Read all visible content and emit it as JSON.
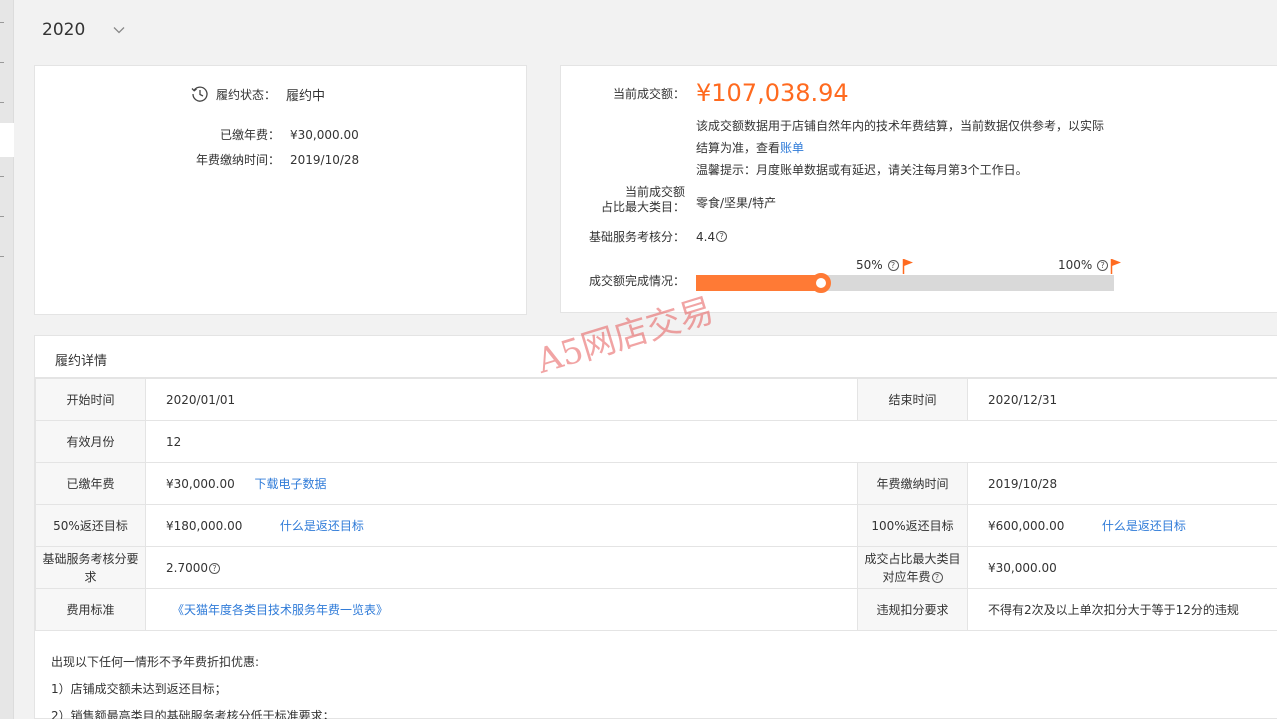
{
  "year_selector": {
    "value": "2020"
  },
  "contract_summary": {
    "status_label": "履约状态：",
    "status_value": "履约中",
    "paid_fee_label": "已缴年费：",
    "paid_fee_value": "¥30,000.00",
    "pay_time_label": "年费缴纳时间：",
    "pay_time_value": "2019/10/28"
  },
  "turnover": {
    "current_label": "当前成交额：",
    "current_value": "¥107,038.94",
    "desc_line1": "该成交额数据用于店铺自然年内的技术年费结算，当前数据仅供参考，以实际",
    "desc_line2_prefix": "结算为准，查看",
    "desc_line2_link": "账单",
    "desc_line3": "温馨提示：月度账单数据或有延迟，请关注每月第3个工作日。",
    "top_category_label_line1": "当前成交额",
    "top_category_label_line2": "占比最大类目：",
    "top_category_value": "零食/坚果/特产",
    "service_score_label": "基础服务考核分：",
    "service_score_value": "4.4",
    "completion_label": "成交额完成情况：",
    "completion_fraction": 0.3,
    "milestone_50": "50%",
    "milestone_100": "100%",
    "accent_color": "#ff7a35"
  },
  "detail": {
    "title": "履约详情",
    "rows": {
      "start_label": "开始时间",
      "start_value": "2020/01/01",
      "end_label": "结束时间",
      "end_value": "2020/12/31",
      "months_label": "有效月份",
      "months_value": "12",
      "fee_label": "已缴年费",
      "fee_value": "¥30,000.00",
      "fee_link": "下载电子数据",
      "pay_time_label": "年费缴纳时间",
      "pay_time_value": "2019/10/28",
      "r50_label": "50%返还目标",
      "r50_value": "¥180,000.00",
      "r50_link": "什么是返还目标",
      "r100_label": "100%返还目标",
      "r100_value": "¥600,000.00",
      "r100_link": "什么是返还目标",
      "score_label": "基础服务考核分要求",
      "score_value": "2.7000",
      "cat_fee_label": "成交占比最大类目对应年费",
      "cat_fee_value": "¥30,000.00",
      "std_label": "费用标准",
      "std_link": "《天猫年度各类目技术服务年费一览表》",
      "penalty_label": "违规扣分要求",
      "penalty_value": "不得有2次及以上单次扣分大于等于12分的违规"
    },
    "notes": {
      "line1": "出现以下任何一情形不予年费折扣优惠:",
      "line2": "1）店铺成交额未达到返还目标；",
      "line3": "2）销售额最高类目的基础服务考核分低于标准要求；"
    }
  },
  "watermark": "A5网店交易"
}
